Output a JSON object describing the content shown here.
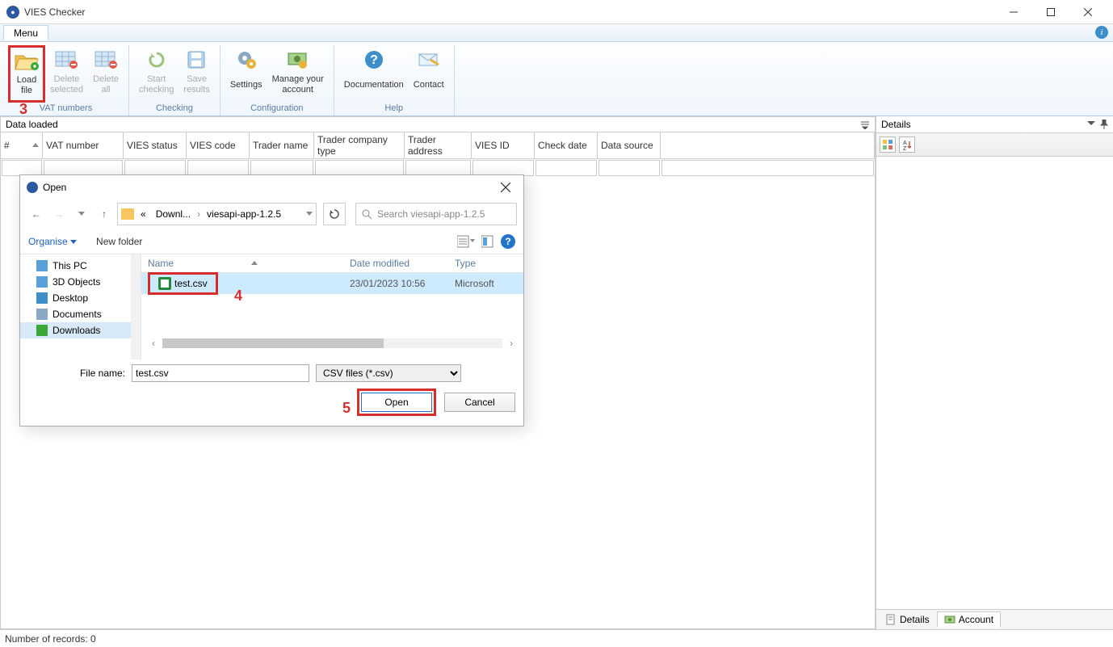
{
  "titlebar": {
    "title": "VIES Checker"
  },
  "menu": {
    "tab": "Menu"
  },
  "ribbon": {
    "groups": {
      "vat": {
        "label": "VAT numbers",
        "load_file": "Load\nfile",
        "delete_selected": "Delete\nselected",
        "delete_all": "Delete\nall"
      },
      "checking": {
        "label": "Checking",
        "start": "Start\nchecking",
        "save": "Save\nresults"
      },
      "configuration": {
        "label": "Configuration",
        "settings": "Settings",
        "manage": "Manage your\naccount"
      },
      "help": {
        "label": "Help",
        "docs": "Documentation",
        "contact": "Contact"
      }
    }
  },
  "grid": {
    "panel_title": "Data loaded",
    "cols": [
      "#",
      "VAT number",
      "VIES status",
      "VIES code",
      "Trader name",
      "Trader company type",
      "Trader address",
      "VIES ID",
      "Check date",
      "Data source"
    ]
  },
  "details": {
    "title": "Details",
    "tabs": {
      "details": "Details",
      "account": "Account"
    }
  },
  "status": {
    "records_label": "Number of records: 0"
  },
  "dialog": {
    "title": "Open",
    "breadcrumb": {
      "prefix": "«",
      "part1": "Downl...",
      "part2": "viesapi-app-1.2.5"
    },
    "search_placeholder": "Search viesapi-app-1.2.5",
    "organise": "Organise",
    "new_folder": "New folder",
    "side_items": [
      "This PC",
      "3D Objects",
      "Desktop",
      "Documents",
      "Downloads"
    ],
    "file_cols": {
      "name": "Name",
      "modified": "Date modified",
      "type": "Type"
    },
    "file": {
      "name": "test.csv",
      "modified": "23/01/2023 10:56",
      "type": "Microsoft"
    },
    "filename_label": "File name:",
    "filename_value": "test.csv",
    "filetype": "CSV files (*.csv)",
    "open_btn": "Open",
    "cancel_btn": "Cancel"
  },
  "annotations": {
    "a3": "3",
    "a4": "4",
    "a5": "5"
  }
}
